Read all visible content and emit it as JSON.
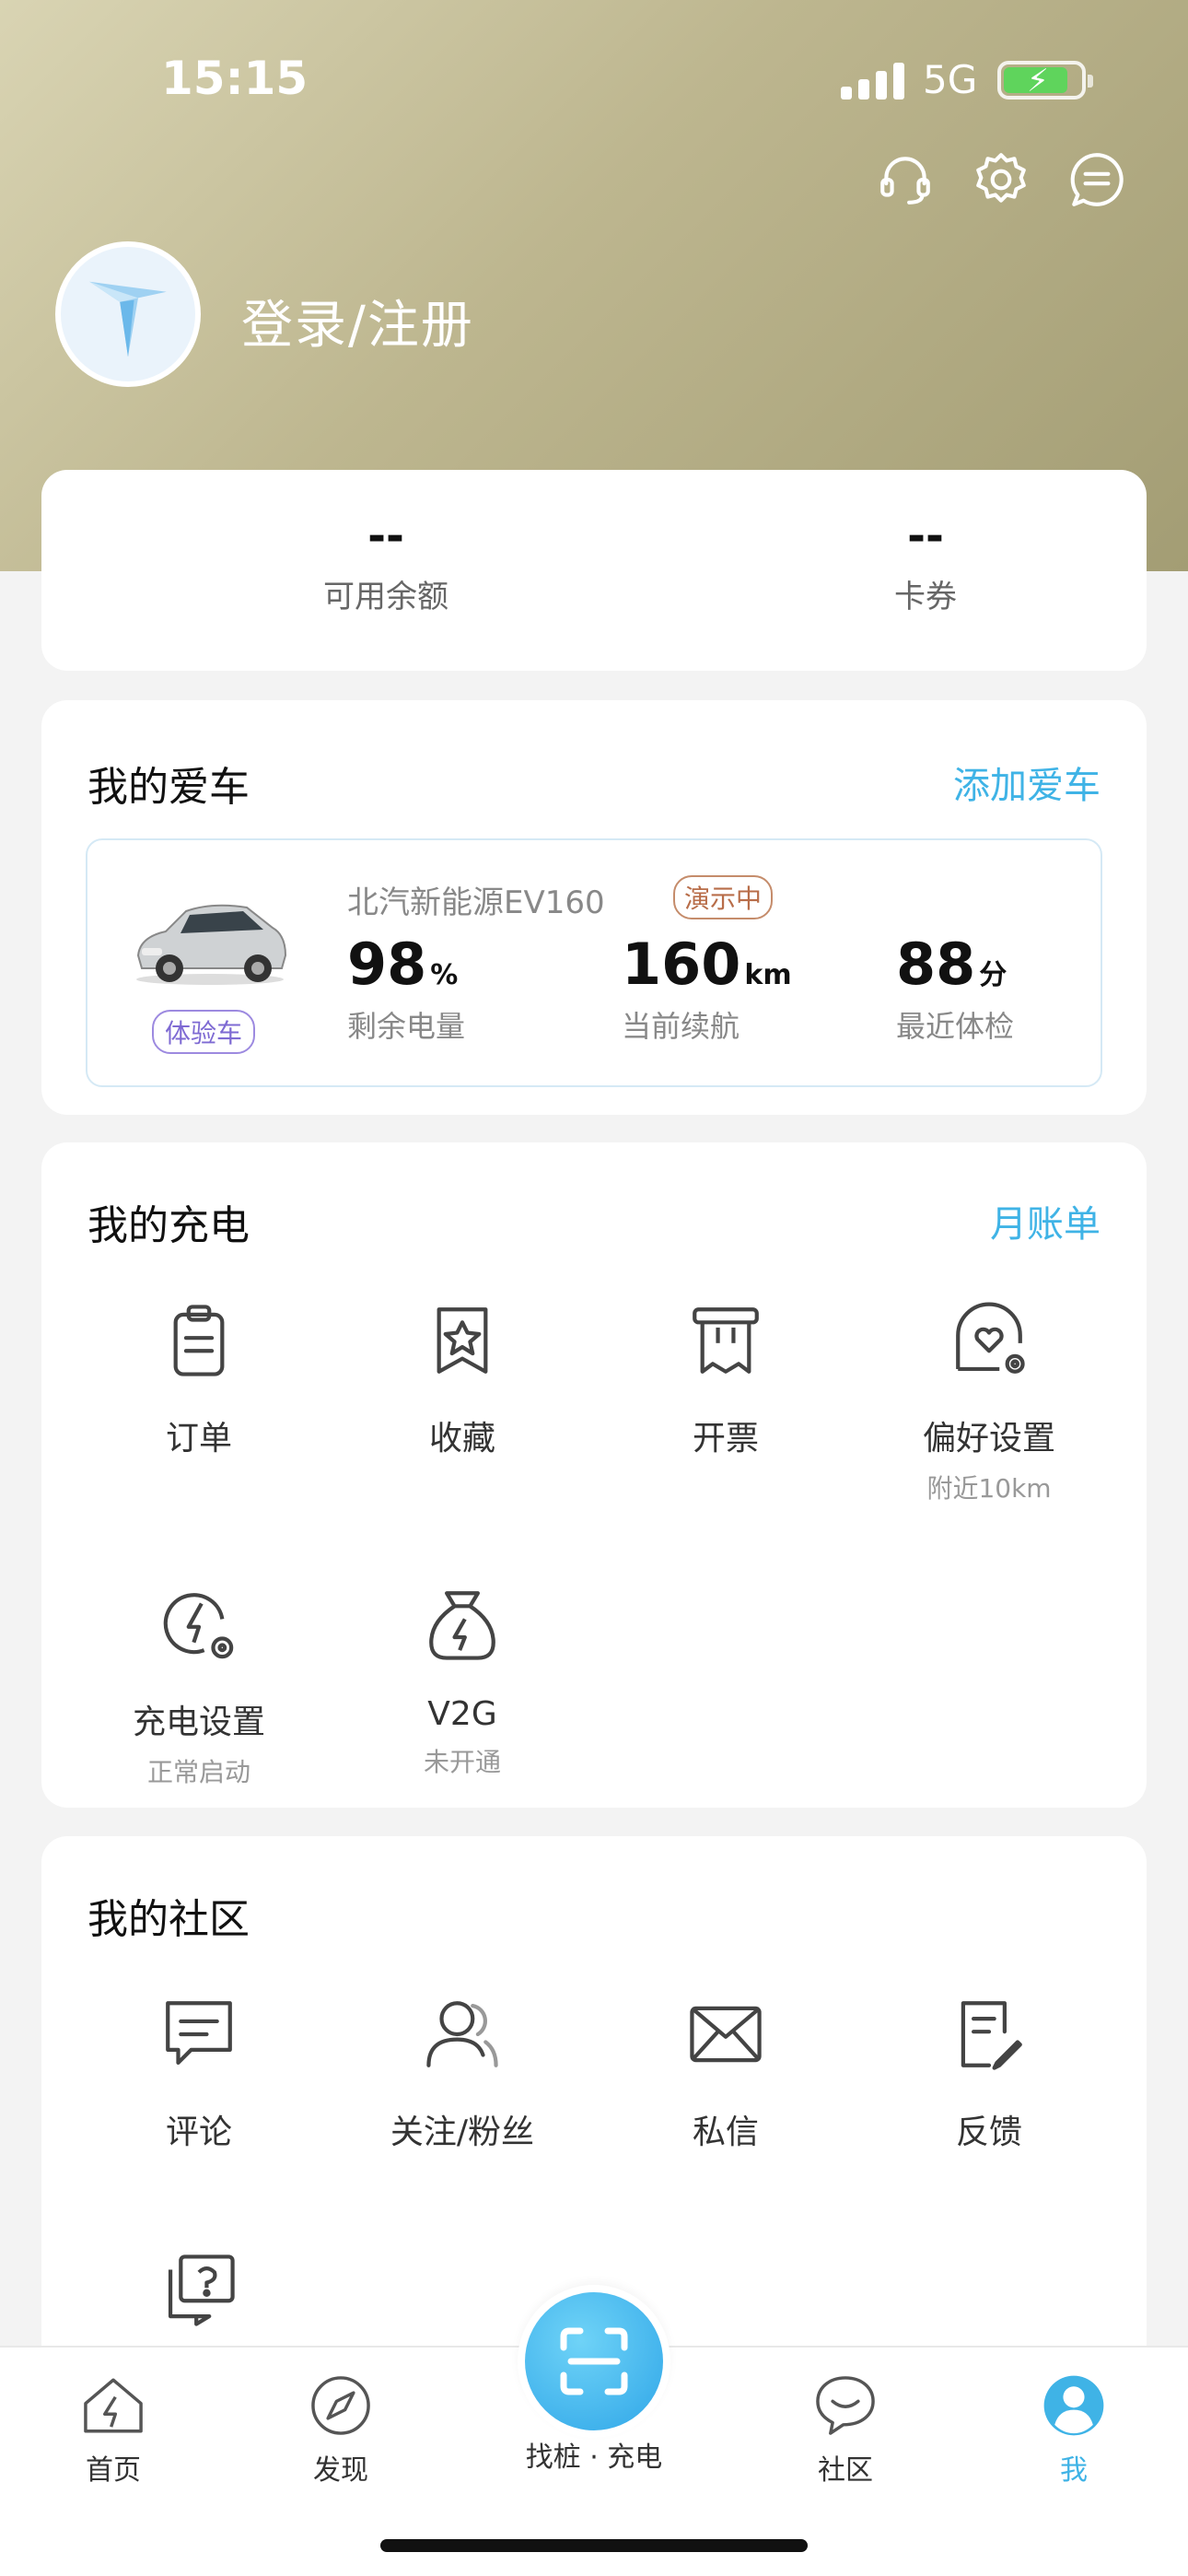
{
  "status_bar": {
    "time": "15:15",
    "network": "5G"
  },
  "header": {
    "login_text": "登录/注册"
  },
  "wallet": {
    "balance_value": "--",
    "balance_label": "可用余额",
    "coupon_value": "--",
    "coupon_label": "卡券"
  },
  "my_car": {
    "title": "我的爱车",
    "add_link": "添加爱车",
    "car_name": "北汽新能源EV160",
    "demo_badge": "演示中",
    "trial_badge": "体验车",
    "battery": {
      "value": "98",
      "unit": "%",
      "label": "剩余电量"
    },
    "range": {
      "value": "160",
      "unit": "km",
      "label": "当前续航"
    },
    "checkup": {
      "value": "88",
      "unit": "分",
      "label": "最近体检"
    }
  },
  "my_charging": {
    "title": "我的充电",
    "bill_link": "月账单",
    "items": [
      {
        "label": "订单",
        "icon": "clipboard-icon"
      },
      {
        "label": "收藏",
        "icon": "star-bookmark-icon"
      },
      {
        "label": "开票",
        "icon": "invoice-icon"
      },
      {
        "label": "偏好设置",
        "sub": "附近10km",
        "icon": "heart-settings-icon"
      },
      {
        "label": "充电设置",
        "sub": "正常启动",
        "icon": "charge-settings-icon"
      },
      {
        "label": "V2G",
        "sub": "未开通",
        "icon": "energy-bag-icon"
      }
    ]
  },
  "my_community": {
    "title": "我的社区",
    "items": [
      {
        "label": "评论",
        "icon": "comment-icon"
      },
      {
        "label": "关注/粉丝",
        "icon": "users-icon"
      },
      {
        "label": "私信",
        "icon": "mail-icon"
      },
      {
        "label": "反馈",
        "icon": "feedback-icon"
      },
      {
        "label": "",
        "icon": "help-icon"
      }
    ]
  },
  "tabbar": {
    "tabs": [
      {
        "label": "首页",
        "icon": "home-bolt-icon"
      },
      {
        "label": "发现",
        "icon": "compass-icon"
      },
      {
        "label": "找桩 · 充电",
        "icon": "scan-icon"
      },
      {
        "label": "社区",
        "icon": "chat-bubble-icon"
      },
      {
        "label": "我",
        "icon": "user-icon",
        "active": true
      }
    ],
    "active_color": "#3fb3e6"
  }
}
